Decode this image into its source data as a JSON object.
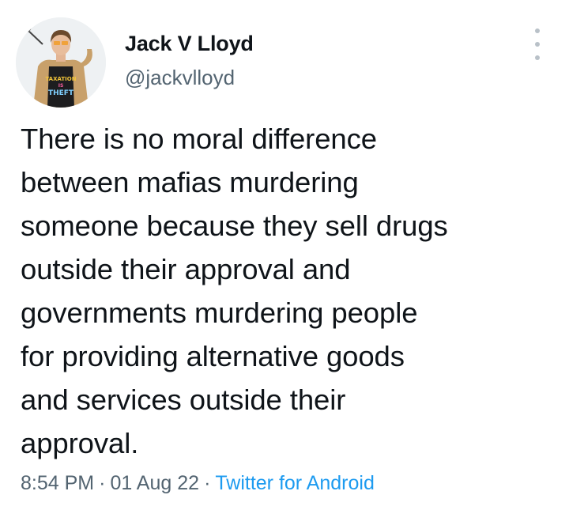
{
  "author": {
    "display_name": "Jack V Lloyd",
    "handle": "@jackvlloyd",
    "avatar_shirt_text": [
      "TAXATION",
      "IS",
      "THEFT"
    ]
  },
  "tweet": {
    "lines": [
      "There is no moral difference",
      "between mafias murdering",
      "someone because they sell drugs",
      "outside their approval and",
      "governments murdering people",
      "for providing alternative goods",
      "and services outside their",
      "approval."
    ]
  },
  "meta": {
    "time": "8:54 PM",
    "separator": "·",
    "date": "01 Aug 22",
    "source": "Twitter for Android"
  },
  "colors": {
    "text": "#0f1419",
    "secondary": "#536471",
    "link": "#1d9bf0"
  },
  "icons": {
    "more": "more-vertical-icon"
  }
}
